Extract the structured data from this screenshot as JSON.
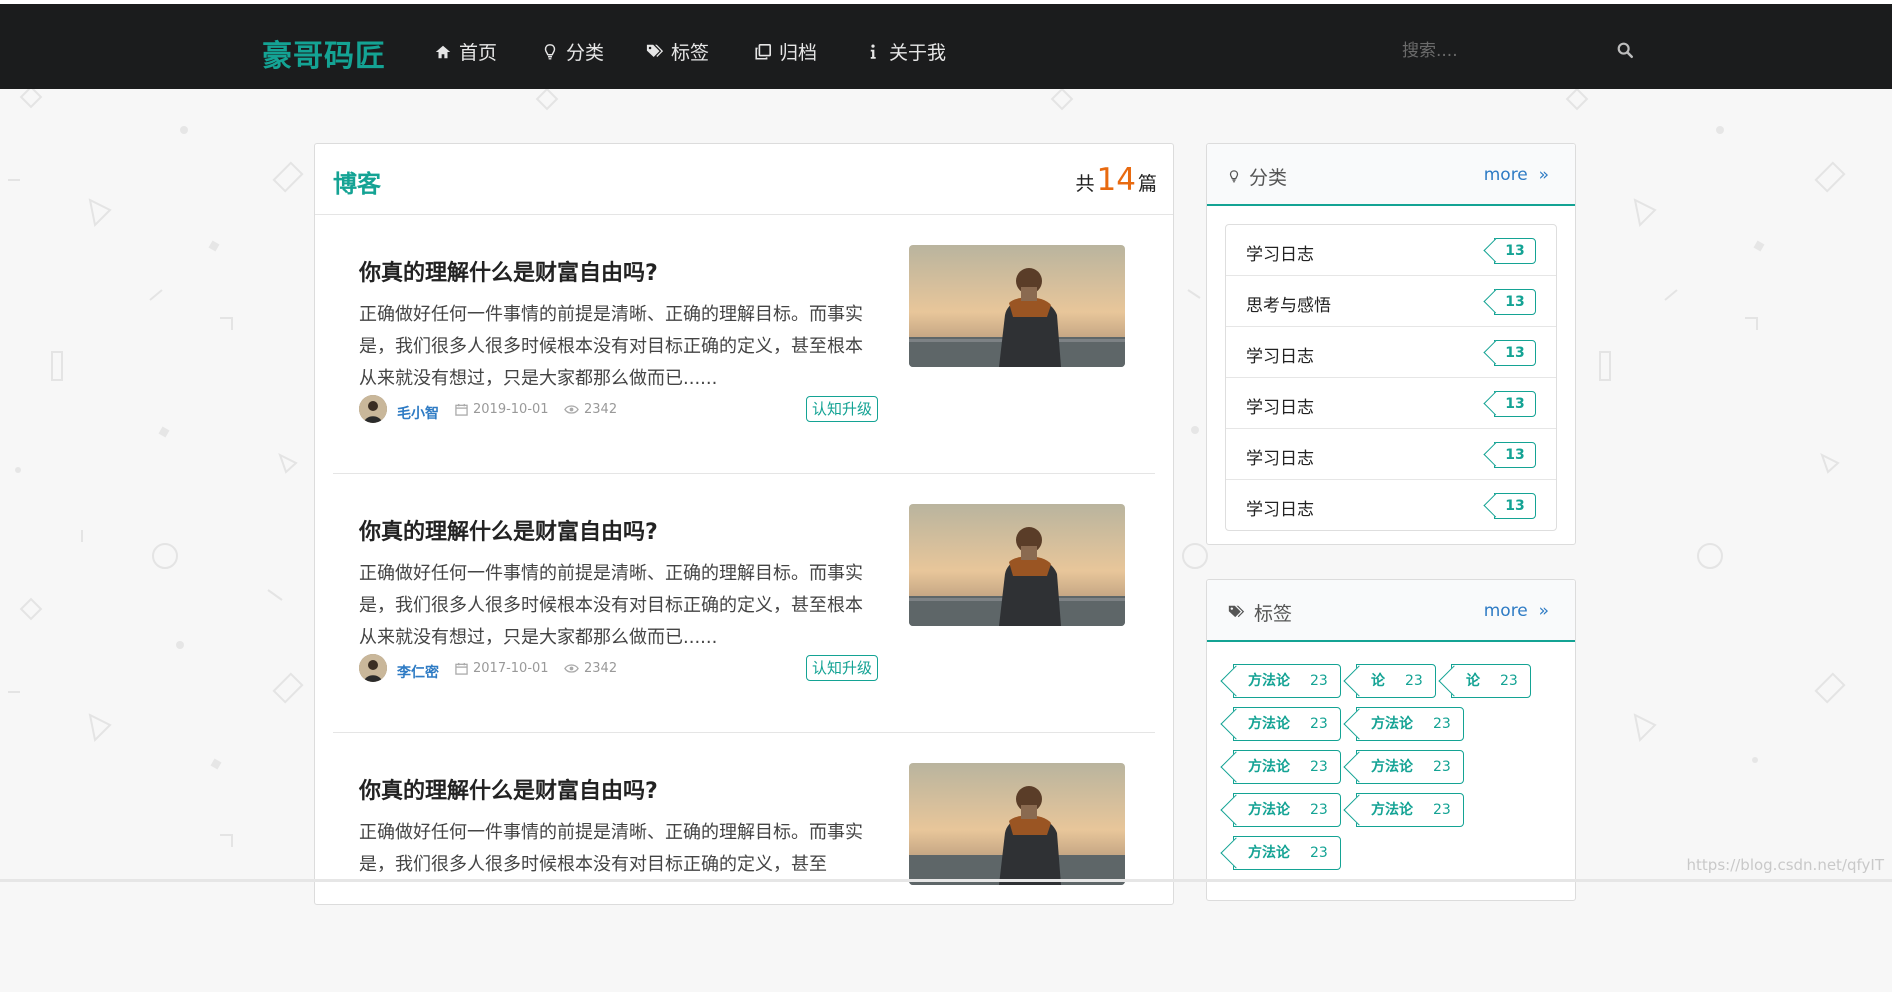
{
  "nav": {
    "logo": "豪哥码匠",
    "items": [
      {
        "label": "首页",
        "icon": "home-icon"
      },
      {
        "label": "分类",
        "icon": "lightbulb-icon"
      },
      {
        "label": "标签",
        "icon": "tags-icon"
      },
      {
        "label": "归档",
        "icon": "clone-icon"
      },
      {
        "label": "关于我",
        "icon": "info-icon"
      }
    ],
    "search_placeholder": "搜索...."
  },
  "main": {
    "title": "博客",
    "count_prefix": "共",
    "count": "14",
    "count_suffix": "篇",
    "posts": [
      {
        "title": "你真的理解什么是财富自由吗?",
        "summary": "正确做好任何一件事情的前提是清晰、正确的理解目标。而事实是，我们很多人很多时候根本没有对目标正确的定义，甚至根本从来就没有想过，只是大家都那么做而已......",
        "author": "毛小智",
        "date": "2019-10-01",
        "views": "2342",
        "tag": "认知升级"
      },
      {
        "title": "你真的理解什么是财富自由吗?",
        "summary": "正确做好任何一件事情的前提是清晰、正确的理解目标。而事实是，我们很多人很多时候根本没有对目标正确的定义，甚至根本从来就没有想过，只是大家都那么做而已......",
        "author": "李仁密",
        "date": "2017-10-01",
        "views": "2342",
        "tag": "认知升级"
      },
      {
        "title": "你真的理解什么是财富自由吗?",
        "summary": "正确做好任何一件事情的前提是清晰、正确的理解目标。而事实是，我们很多人很多时候根本没有对目标正确的定义，甚至",
        "author": "",
        "date": "",
        "views": "",
        "tag": ""
      }
    ]
  },
  "sidebar": {
    "categories": {
      "title": "分类",
      "more": "more",
      "items": [
        {
          "name": "学习日志",
          "count": "13"
        },
        {
          "name": "思考与感悟",
          "count": "13"
        },
        {
          "name": "学习日志",
          "count": "13"
        },
        {
          "name": "学习日志",
          "count": "13"
        },
        {
          "name": "学习日志",
          "count": "13"
        },
        {
          "name": "学习日志",
          "count": "13"
        }
      ]
    },
    "tags": {
      "title": "标签",
      "more": "more",
      "items": [
        {
          "name": "方法论",
          "count": "23"
        },
        {
          "name": "论",
          "count": "23"
        },
        {
          "name": "论",
          "count": "23"
        },
        {
          "name": "方法论",
          "count": "23"
        },
        {
          "name": "方法论",
          "count": "23"
        },
        {
          "name": "方法论",
          "count": "23"
        },
        {
          "name": "方法论",
          "count": "23"
        },
        {
          "name": "方法论",
          "count": "23"
        },
        {
          "name": "方法论",
          "count": "23"
        },
        {
          "name": "方法论",
          "count": "23"
        }
      ]
    }
  },
  "watermark": "https://blog.csdn.net/qfyIT",
  "colors": {
    "accent": "#14a394",
    "nav_bg": "#1b1c1d",
    "count_orange": "#e86a10",
    "link_blue": "#2e7bc4"
  }
}
